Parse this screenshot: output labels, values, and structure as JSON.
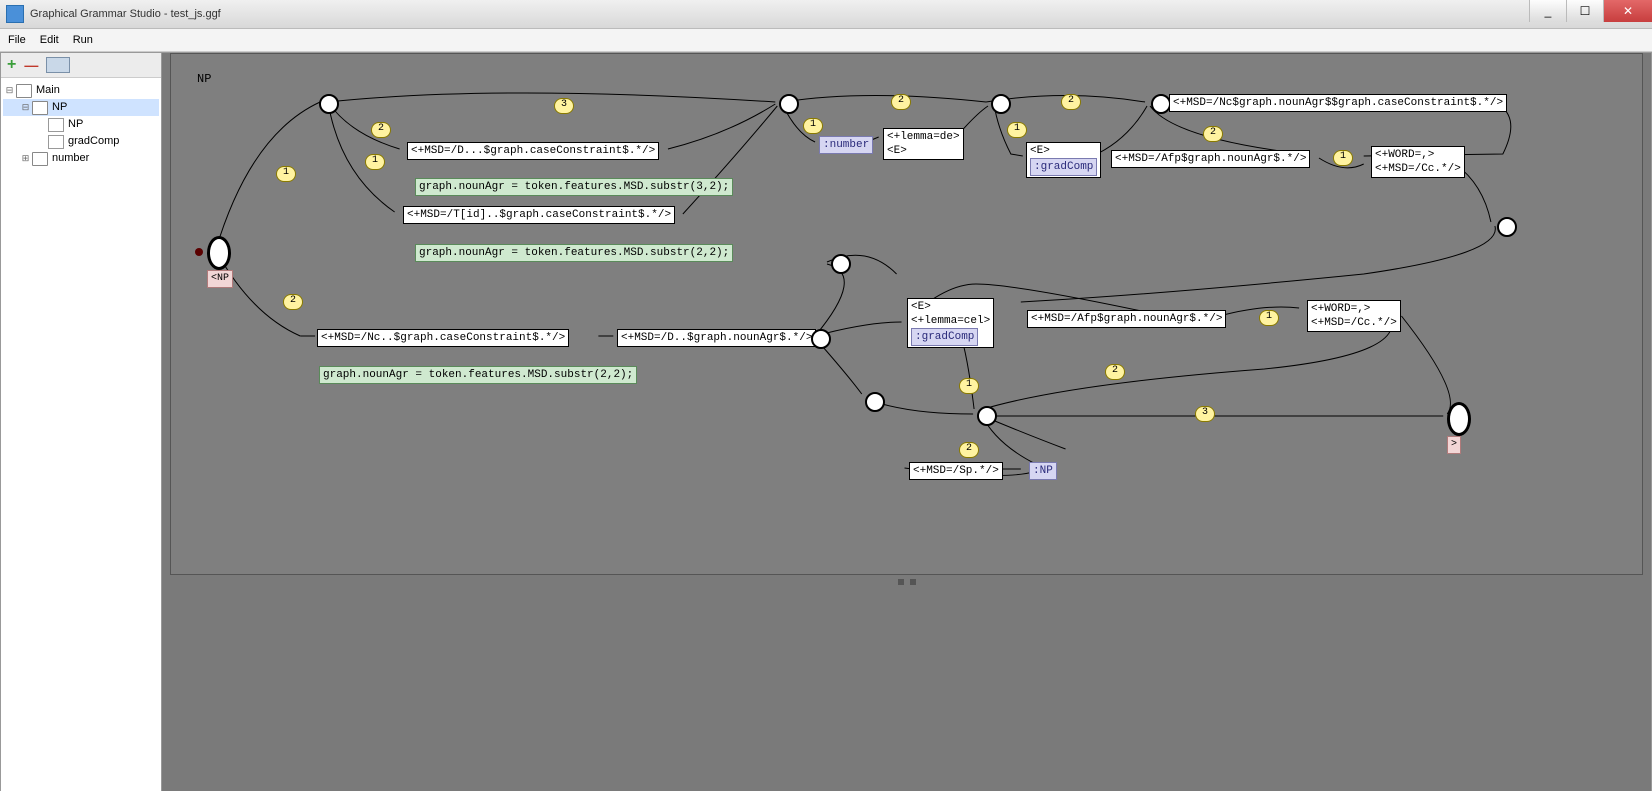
{
  "window": {
    "title": "Graphical Grammar Studio - test_js.ggf"
  },
  "menu": {
    "file": "File",
    "edit": "Edit",
    "run": "Run"
  },
  "winbtns": {
    "min": "_",
    "max": "☐",
    "close": "✕"
  },
  "toolbar": {
    "add": "+",
    "del": "—"
  },
  "tree": {
    "root": "Main",
    "np_folder": "NP",
    "np_file": "NP",
    "gradComp": "gradComp",
    "number": "number"
  },
  "graph": {
    "title": "NP",
    "start_label": "<NP",
    "end_label": ">",
    "pills": {
      "p1": "1",
      "p2": "2",
      "p3": "3"
    },
    "nodes": {
      "d_case": "<+MSD=/D...$graph.caseConstraint$.*/>",
      "nounAgr32": "graph.nounAgr = token.features.MSD.substr(3,2);",
      "t_case": "<+MSD=/T[id]..$graph.caseConstraint$.*/>",
      "nounAgr22a": "graph.nounAgr = token.features.MSD.substr(2,2);",
      "nc_case": "<+MSD=/Nc..$graph.caseConstraint$.*/>",
      "nounAgr22b": "graph.nounAgr = token.features.MSD.substr(2,2);",
      "d_nounAgr": "<+MSD=/D..$graph.nounAgr$.*/>",
      "number_ref": ":number",
      "lemma_de_l1": "<+lemma=de>",
      "lemma_de_l2": "<E>",
      "e_grad_l1": "<E>",
      "e_grad_ref": ":gradComp",
      "nc_big": "<+MSD=/Nc$graph.nounAgr$$graph.caseConstraint$.*/>",
      "afp1": "<+MSD=/Afp$graph.nounAgr$.*/>",
      "word_cc_l1": "<+WORD=,>",
      "word_cc_l2": "<+MSD=/Cc.*/>",
      "cel_l1": "<E>",
      "cel_l2": "<+lemma=cel>",
      "cel_ref": ":gradComp",
      "afp2": "<+MSD=/Afp$graph.nounAgr$.*/>",
      "word_cc2_l1": "<+WORD=,>",
      "word_cc2_l2": "<+MSD=/Cc.*/>",
      "sp": "<+MSD=/Sp.*/>",
      "np_ref": ":NP"
    }
  }
}
